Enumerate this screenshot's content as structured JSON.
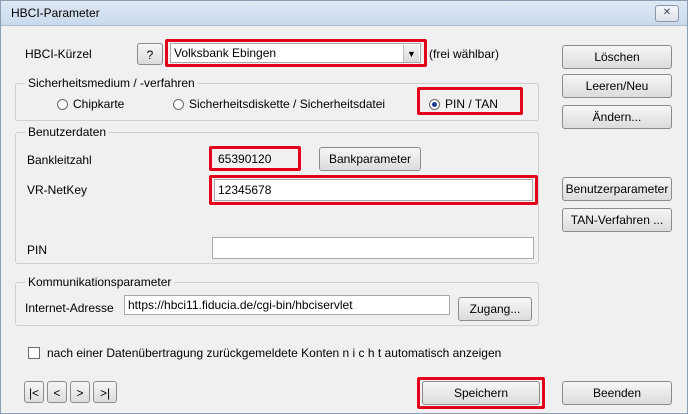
{
  "window": {
    "title": "HBCI-Parameter",
    "close_glyph": "✕"
  },
  "hbci": {
    "label": "HBCI-Kürzel",
    "help_label": "?",
    "value": "Volksbank Ebingen",
    "hint": "(frei wählbar)"
  },
  "security": {
    "legend": "Sicherheitsmedium / -verfahren",
    "options": [
      {
        "label": "Chipkarte",
        "selected": false
      },
      {
        "label": "Sicherheitsdiskette / Sicherheitsdatei",
        "selected": false
      },
      {
        "label": "PIN / TAN",
        "selected": true
      }
    ]
  },
  "user": {
    "legend": "Benutzerdaten",
    "blz_label": "Bankleitzahl",
    "blz_value": "65390120",
    "bankparam_button": "Bankparameter",
    "netkey_label": "VR-NetKey",
    "netkey_value": "12345678",
    "pin_label": "PIN",
    "pin_value": ""
  },
  "comm": {
    "legend": "Kommunikationsparameter",
    "address_label": "Internet-Adresse",
    "address_value": "https://hbci11.fiducia.de/cgi-bin/hbciservlet",
    "access_button": "Zugang..."
  },
  "option_checkbox": {
    "label": "nach einer Datenübertragung zurückgemeldete Konten  n i c h t  automatisch anzeigen",
    "checked": false
  },
  "nav": [
    "|<",
    "<",
    ">",
    ">|"
  ],
  "side_buttons": {
    "delete": "Löschen",
    "clear_new": "Leeren/Neu",
    "change": "Ändern...",
    "user_params": "Benutzerparameter",
    "tan_methods": "TAN-Verfahren ..."
  },
  "bottom_buttons": {
    "save": "Speichern",
    "exit": "Beenden"
  },
  "highlight_color": "#e3001b"
}
